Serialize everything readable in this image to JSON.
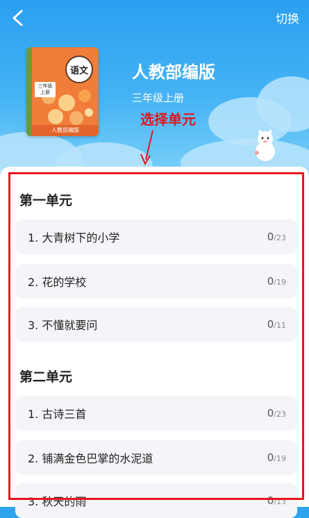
{
  "header": {
    "switch_label": "切换",
    "book_title": "人教部编版",
    "book_subtitle": "三年级上册"
  },
  "book_cover": {
    "subject": "语文",
    "grade_line1": "三年级",
    "grade_line2": "上册",
    "publisher": "人教部编版"
  },
  "annotation": "选择单元",
  "units": [
    {
      "title": "第一单元",
      "lessons": [
        {
          "name": "1. 大青树下的小学",
          "done": "0",
          "total": "/23"
        },
        {
          "name": "2. 花的学校",
          "done": "0",
          "total": "/19"
        },
        {
          "name": "3. 不懂就要问",
          "done": "0",
          "total": "/11"
        }
      ]
    },
    {
      "title": "第二单元",
      "lessons": [
        {
          "name": "1. 古诗三首",
          "done": "0",
          "total": "/23"
        },
        {
          "name": "2. 铺满金色巴掌的水泥道",
          "done": "0",
          "total": "/19"
        },
        {
          "name": "3. 秋天的雨",
          "done": "0",
          "total": "/13"
        }
      ]
    }
  ],
  "colors": {
    "header_blue": "#2a9ff0",
    "annotation_red": "#e4141b",
    "cover_orange": "#f07d3a"
  }
}
